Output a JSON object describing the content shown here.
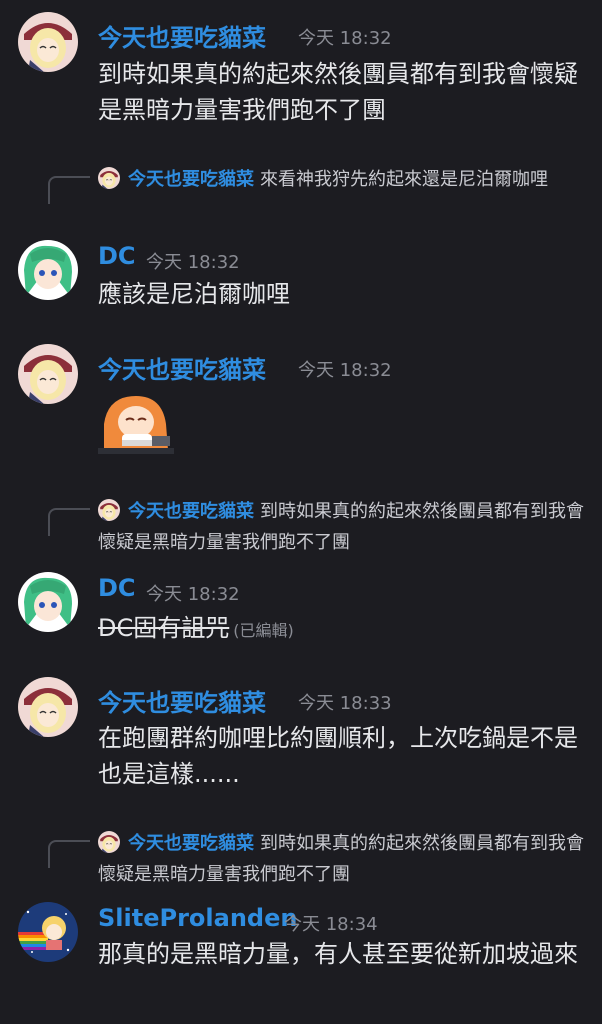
{
  "messages": [
    {
      "author": "今天也要吃貓菜",
      "time": "今天 18:32",
      "text": "到時如果真的約起來然後團員都有到我會懷疑是黑暗力量害我們跑不了團"
    },
    {
      "reply": {
        "author": "今天也要吃貓菜",
        "text": "來看神我狩先約起來還是尼泊爾咖哩"
      },
      "author": "DC",
      "time": "今天 18:32",
      "text": "應該是尼泊爾咖哩"
    },
    {
      "author": "今天也要吃貓菜",
      "time": "今天 18:32",
      "sticker": "sticker-girl-eating"
    },
    {
      "reply": {
        "author": "今天也要吃貓菜",
        "text": "到時如果真的約起來然後團員都有到我會懷疑是黑暗力量害我們跑不了團"
      },
      "author": "DC",
      "time": "今天 18:32",
      "text": "DC固有詛咒",
      "edited": "(已編輯)"
    },
    {
      "author": "今天也要吃貓菜",
      "time": "今天 18:33",
      "text": "在跑團群約咖哩比約團順利，上次吃鍋是不是也是這樣......"
    },
    {
      "reply": {
        "author": "今天也要吃貓菜",
        "text": "到時如果真的約起來然後團員都有到我會懷疑是黑暗力量害我們跑不了團"
      },
      "author": "SliteProlanden",
      "time": "今天 18:34",
      "text": "那真的是黑暗力量，有人甚至要從新加坡過來"
    }
  ],
  "colors": {
    "background": "#1c1c21",
    "name_blue": "#2f8de0",
    "timestamp": "#8a8c94"
  }
}
